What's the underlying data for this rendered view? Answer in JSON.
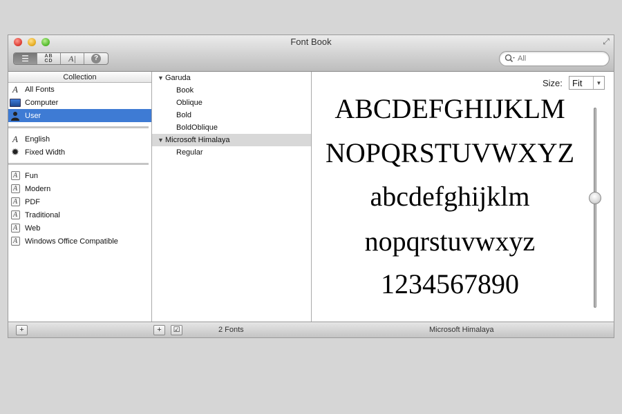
{
  "window": {
    "title": "Font Book"
  },
  "toolbar": {
    "view_buttons": [
      {
        "name": "list-view",
        "label": ""
      },
      {
        "name": "sample-view",
        "label": "AB CD"
      },
      {
        "name": "custom-view",
        "label": "AI"
      },
      {
        "name": "help",
        "label": "?"
      }
    ],
    "search": {
      "placeholder": "All"
    }
  },
  "collections": {
    "header": "Collection",
    "group1": [
      {
        "label": "All Fonts",
        "icon": "font-icon",
        "selected": false
      },
      {
        "label": "Computer",
        "icon": "computer-icon",
        "selected": false
      },
      {
        "label": "User",
        "icon": "user-icon",
        "selected": true
      }
    ],
    "group2": [
      {
        "label": "English",
        "icon": "font-icon"
      },
      {
        "label": "Fixed Width",
        "icon": "gear-icon"
      }
    ],
    "group3": [
      {
        "label": "Fun",
        "icon": "font-box-icon"
      },
      {
        "label": "Modern",
        "icon": "font-box-icon"
      },
      {
        "label": "PDF",
        "icon": "font-box-icon"
      },
      {
        "label": "Traditional",
        "icon": "font-box-icon"
      },
      {
        "label": "Web",
        "icon": "font-box-icon"
      },
      {
        "label": "Windows Office Compatible",
        "icon": "font-box-icon"
      }
    ]
  },
  "fonts": {
    "families": [
      {
        "name": "Garuda",
        "expanded": true,
        "styles": [
          "Book",
          "Oblique",
          "Bold",
          "BoldOblique"
        ]
      },
      {
        "name": "Microsoft Himalaya",
        "expanded": true,
        "highlighted": true,
        "styles": [
          "Regular"
        ]
      }
    ]
  },
  "preview": {
    "size_label": "Size:",
    "size_value": "Fit",
    "sample_lines": [
      "ABCDEFGHIJKLM",
      "NOPQRSTUVWXYZ",
      "abcdefghijklm",
      "nopqrstuvwxyz",
      "1234567890"
    ],
    "slider_level": 0.45
  },
  "status": {
    "font_count": "2 Fonts",
    "preview_font": "Microsoft Himalaya"
  },
  "colors": {
    "selection": "#3e7bd4",
    "highlight": "#d8d8d8"
  }
}
